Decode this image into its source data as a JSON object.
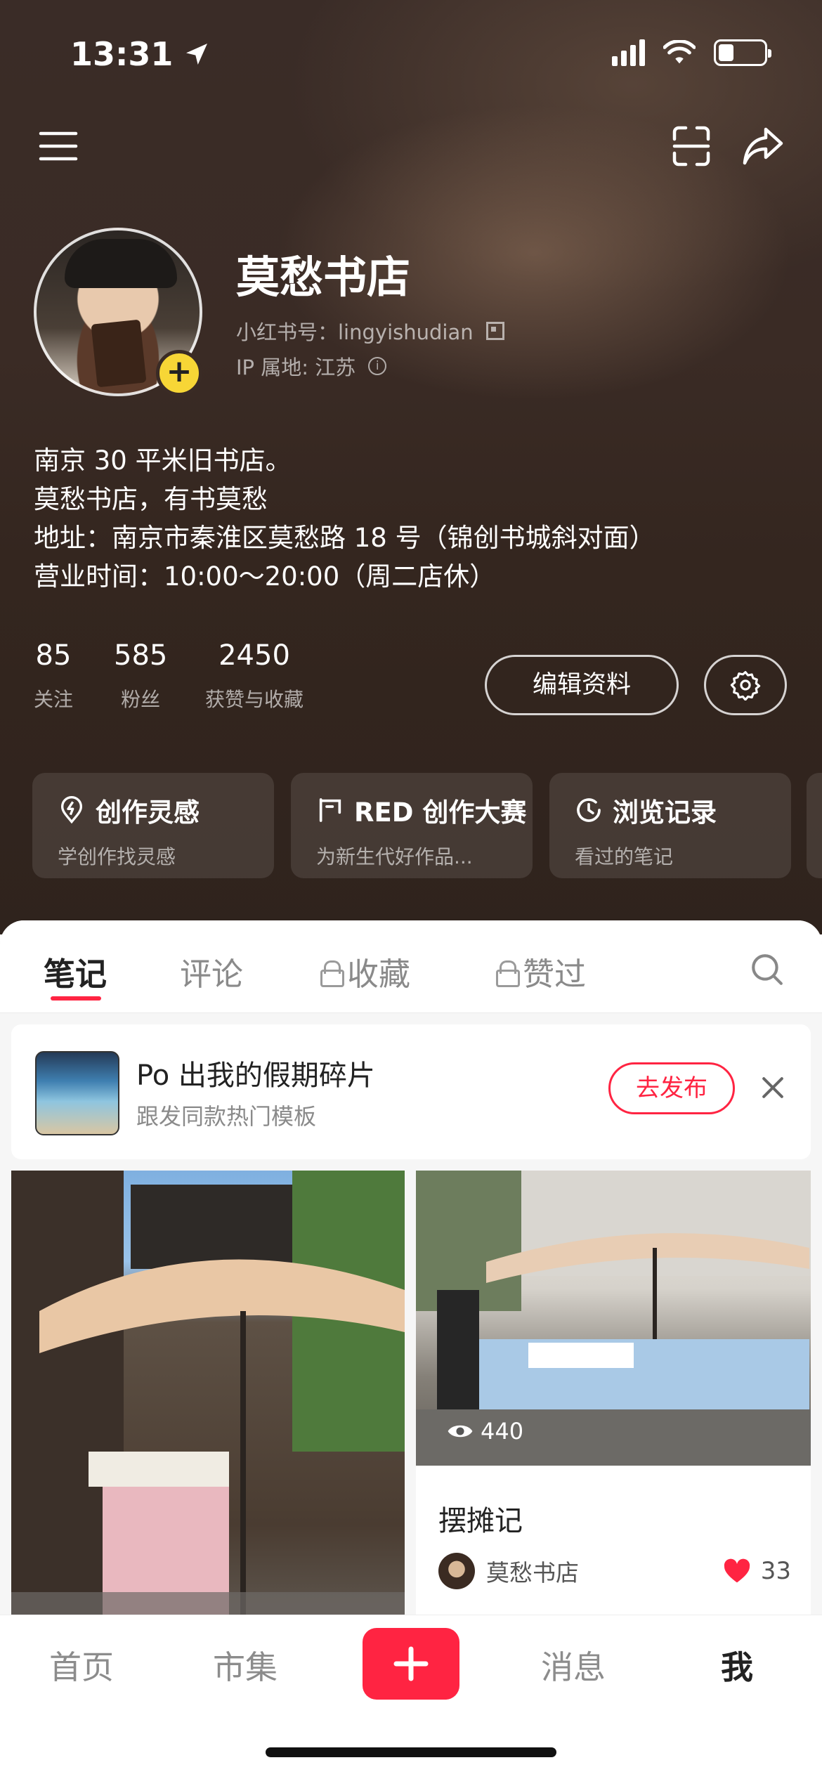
{
  "status_bar": {
    "time": "13:31"
  },
  "profile": {
    "nickname": "莫愁书店",
    "red_id_label": "小红书号：lingyishudian",
    "ip_label": "IP 属地: 江苏",
    "bio": [
      "南京 30 平米旧书店。",
      "莫愁书店，有书莫愁",
      "地址：南京市秦淮区莫愁路 18 号（锦创书城斜对面）",
      "营业时间：10:00～20:00（周二店休）"
    ]
  },
  "stats": [
    {
      "value": "85",
      "label": "关注"
    },
    {
      "value": "585",
      "label": "粉丝"
    },
    {
      "value": "2450",
      "label": "获赞与收藏"
    }
  ],
  "buttons": {
    "edit_profile": "编辑资料"
  },
  "cards": [
    {
      "title": "创作灵感",
      "subtitle": "学创作找灵感",
      "icon": "lightbulb-pin-icon"
    },
    {
      "title": "RED 创作大赛",
      "subtitle": "为新生代好作品...",
      "icon": "frame-icon"
    },
    {
      "title": "浏览记录",
      "subtitle": "看过的笔记",
      "icon": "clock-icon"
    }
  ],
  "tabs": [
    {
      "label": "笔记",
      "active": true
    },
    {
      "label": "评论",
      "active": false
    },
    {
      "label": "收藏",
      "active": false,
      "locked": true
    },
    {
      "label": "赞过",
      "active": false,
      "locked": true
    }
  ],
  "promo": {
    "title": "Po 出我的假期碎片",
    "subtitle": "跟发同款热门模板",
    "button": "去发布"
  },
  "notes": [
    {
      "title": "摆摊记",
      "author": "莫愁书店",
      "views": "440",
      "likes": "33"
    }
  ],
  "bottom_nav": [
    {
      "label": "首页",
      "active": false
    },
    {
      "label": "市集",
      "active": false
    },
    {
      "label": "消息",
      "active": false
    },
    {
      "label": "我",
      "active": true
    }
  ],
  "colors": {
    "accent": "#ff2442",
    "badge": "#f7d636",
    "header_bg": "#3a2b25"
  }
}
